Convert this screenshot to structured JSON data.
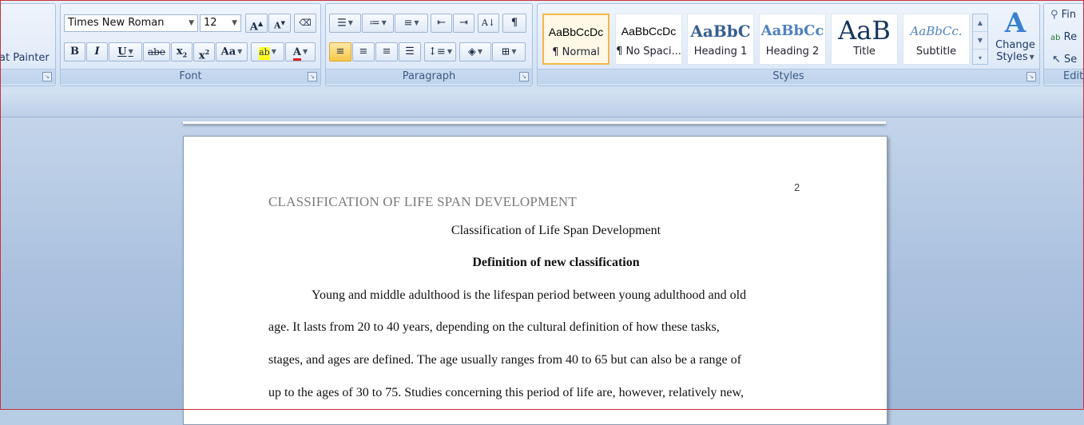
{
  "clipboard": {
    "format_painter_label": "at Painter"
  },
  "font": {
    "group_label": "Font",
    "family": "Times New Roman",
    "size": "12",
    "grow_label": "A",
    "shrink_label": "A",
    "bold": "B",
    "italic": "I",
    "underline": "U",
    "strike": "abe",
    "subscript": "x",
    "superscript": "x",
    "change_case": "Aa",
    "highlight": "ab",
    "color_glyph": "A"
  },
  "paragraph": {
    "group_label": "Paragraph"
  },
  "styles": {
    "group_label": "Styles",
    "items": [
      {
        "sample": "AaBbCcDc",
        "name": "¶ Normal"
      },
      {
        "sample": "AaBbCcDc",
        "name": "¶ No Spaci..."
      },
      {
        "sample": "AaBbC",
        "name": "Heading 1"
      },
      {
        "sample": "AaBbCc",
        "name": "Heading 2"
      },
      {
        "sample": "AaB",
        "name": "Title"
      },
      {
        "sample": "AaBbCc.",
        "name": "Subtitle"
      }
    ],
    "change_styles_line1": "Change",
    "change_styles_line2": "Styles"
  },
  "editing": {
    "group_label": "Edit",
    "find": "Fin",
    "replace": "Re",
    "select": "Se"
  },
  "document": {
    "page_number": "2",
    "running_head": "CLASSIFICATION OF LIFE SPAN DEVELOPMENT",
    "title": "Classification of Life Span Development",
    "heading": "Definition of new classification",
    "lines": [
      "Young and middle adulthood is the lifespan period between young adulthood and old",
      "age. It lasts from 20 to 40 years, depending on the cultural definition of how these tasks,",
      "stages, and ages are defined. The age usually ranges from 40 to 65 but can also be a range of",
      "up to the ages of 30 to 75. Studies concerning this period of life are, however, relatively new,"
    ]
  }
}
